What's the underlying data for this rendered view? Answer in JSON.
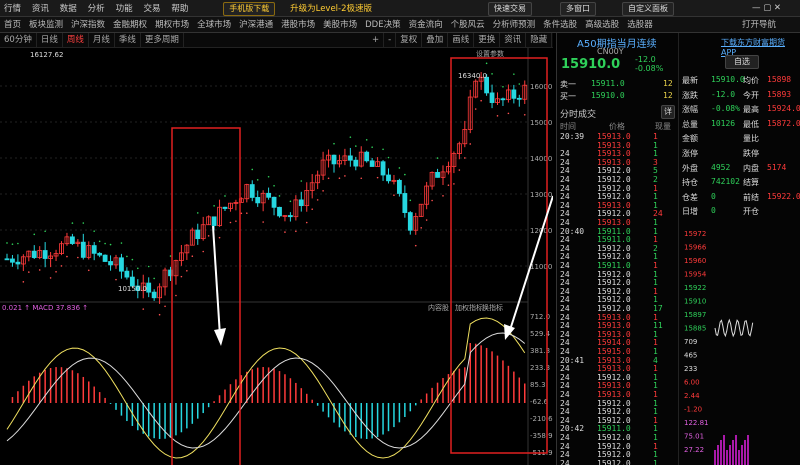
{
  "topbar": {
    "menus": [
      "行情",
      "资讯",
      "数据",
      "分析",
      "功能",
      "交易",
      "帮助"
    ],
    "phone_btn": "手机版下载",
    "promo": "升级为Level-2极速版",
    "quick_trade": "快速交易",
    "multi_window": "多窗口",
    "custom_board": "自定义面板"
  },
  "menubar": {
    "items": [
      "首页",
      "板块监测",
      "沪深指数",
      "金融期权",
      "期权市场",
      "全球市场",
      "沪深港通",
      "港股市场",
      "美股市场",
      "DDE决策",
      "资金流向",
      "个股风云",
      "分析师预测",
      "条件选股",
      "高级选股",
      "选股器",
      "打开导航",
      "下载东方财富期货APP"
    ]
  },
  "chartbar": {
    "periods": [
      "60分钟",
      "日线",
      "周线",
      "月线",
      "季线",
      "更多周期"
    ],
    "active": "周线",
    "tools": [
      "+",
      "-",
      "复权",
      "叠加",
      "画线",
      "更换",
      "资讯",
      "隐藏"
    ],
    "settings": "设置参数"
  },
  "chart": {
    "price_hi_label": "16340.0",
    "price_lo_label": "10150.0",
    "ma_label": "0.021 ↑ MACD 37.836 ↑",
    "yticks_main": [
      "16000.0",
      "15000.0",
      "14000.0",
      "13000.0",
      "12000.0",
      "11000.0"
    ],
    "yticks_sub": [
      "712.0",
      "529.4",
      "381.3",
      "233.3",
      "85.3",
      "-62.6",
      "-210.6",
      "-358.9",
      "-511.9"
    ],
    "sub_tabs": [
      "内容股",
      "加权指标",
      "换指标"
    ],
    "time_label": "16127.62"
  },
  "quote": {
    "name": "A50期指当月连续",
    "code": "CN00Y",
    "price": "15910.0",
    "change": "-12.0",
    "change_pct": "-0.08%",
    "ask": {
      "label": "卖一",
      "price": "15911.0",
      "vol": "12"
    },
    "bid": {
      "label": "买一",
      "price": "15910.0",
      "vol": "12"
    },
    "trades_title": "分时成交",
    "detail_btn": "详",
    "cols": [
      "时间",
      "价格",
      "现量"
    ]
  },
  "trades": [
    [
      "20:39",
      "15913.0",
      "1"
    ],
    [
      "",
      "15913.0",
      "1"
    ],
    [
      "24",
      "15913.0",
      "1"
    ],
    [
      "24",
      "15913.0",
      "3"
    ],
    [
      "24",
      "15912.0",
      "5"
    ],
    [
      "24",
      "15912.0",
      "2"
    ],
    [
      "24",
      "15912.0",
      "1"
    ],
    [
      "24",
      "15912.0",
      "1"
    ],
    [
      "24",
      "15913.0",
      "1"
    ],
    [
      "24",
      "15912.0",
      "24"
    ],
    [
      "24",
      "15913.0",
      "1"
    ],
    [
      "20:40",
      "15911.0",
      "1"
    ],
    [
      "24",
      "15911.0",
      "1"
    ],
    [
      "24",
      "15912.0",
      "2"
    ],
    [
      "24",
      "15912.0",
      "1"
    ],
    [
      "24",
      "15911.0",
      "1"
    ],
    [
      "24",
      "15912.0",
      "1"
    ],
    [
      "24",
      "15912.0",
      "1"
    ],
    [
      "24",
      "15912.0",
      "1"
    ],
    [
      "24",
      "15912.0",
      "1"
    ],
    [
      "24",
      "15912.0",
      "17"
    ],
    [
      "24",
      "15913.0",
      "1"
    ],
    [
      "24",
      "15913.0",
      "11"
    ],
    [
      "24",
      "15913.0",
      "1"
    ],
    [
      "24",
      "15914.0",
      "1"
    ],
    [
      "24",
      "15915.0",
      "1"
    ],
    [
      "20:41",
      "15913.0",
      "4"
    ],
    [
      "24",
      "15913.0",
      "1"
    ],
    [
      "24",
      "15912.0",
      "1"
    ],
    [
      "24",
      "15913.0",
      "1"
    ],
    [
      "24",
      "15913.0",
      "1"
    ],
    [
      "24",
      "15912.0",
      "1"
    ],
    [
      "24",
      "15912.0",
      "1"
    ],
    [
      "24",
      "15912.0",
      "1"
    ],
    [
      "20:42",
      "15911.0",
      "1"
    ],
    [
      "24",
      "15912.0",
      "1"
    ],
    [
      "24",
      "15912.0",
      "1"
    ],
    [
      "24",
      "15912.0",
      "1"
    ],
    [
      "24",
      "15912.0",
      "1"
    ]
  ],
  "fund": {
    "title": "下载东方财富期货APP",
    "btn": "自选",
    "rows": [
      [
        "最新",
        "15910.0",
        "均价",
        "15898"
      ],
      [
        "涨跌",
        "-12.0",
        "今开",
        "15893"
      ],
      [
        "涨幅",
        "-0.08%",
        "最高",
        "15924.0"
      ],
      [
        "总量",
        "10126",
        "最低",
        "15872.0"
      ],
      [
        "金额",
        "",
        "量比",
        ""
      ],
      [
        "涨停",
        "",
        "跌停",
        ""
      ],
      [
        "外盘",
        "4952",
        "内盘",
        "5174"
      ],
      [
        "持仓",
        "742102",
        "结算",
        ""
      ],
      [
        "仓差",
        "0",
        "前结",
        "15922.0"
      ],
      [
        "日增",
        "0",
        "开仓",
        ""
      ]
    ],
    "levels": [
      "15972",
      "15966",
      "15960",
      "15954",
      "15922",
      "15910",
      "15897",
      "15885",
      "709",
      "465",
      "233",
      "6.00",
      "2.44",
      "-1.20",
      "122.81",
      "75.01",
      "27.22"
    ]
  },
  "colors": {
    "up": "#ff3b3b",
    "down": "#26d7e0",
    "box": "#e02020"
  }
}
